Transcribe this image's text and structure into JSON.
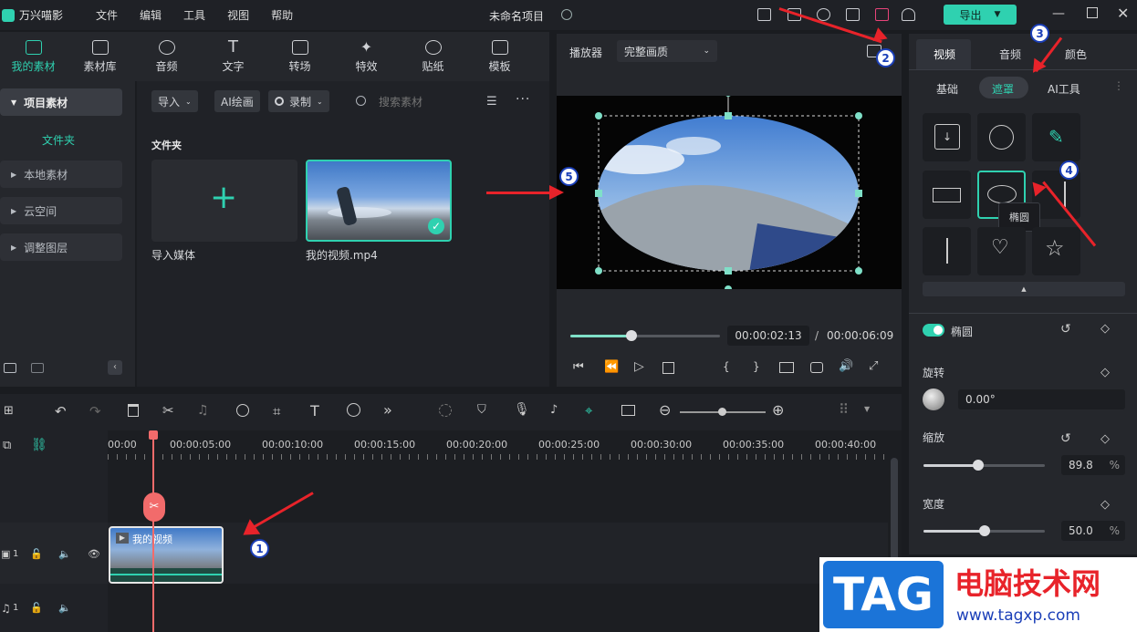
{
  "app": {
    "name": "万兴喵影",
    "project_title": "未命名项目"
  },
  "menu": [
    "文件",
    "编辑",
    "工具",
    "视图",
    "帮助"
  ],
  "export_label": "导出",
  "tabs": [
    {
      "label": "我的素材",
      "icon": "media-icon"
    },
    {
      "label": "素材库",
      "icon": "library-icon"
    },
    {
      "label": "音频",
      "icon": "music-icon"
    },
    {
      "label": "文字",
      "icon": "text-icon"
    },
    {
      "label": "转场",
      "icon": "transition-icon"
    },
    {
      "label": "特效",
      "icon": "effects-icon"
    },
    {
      "label": "贴纸",
      "icon": "sticker-icon"
    },
    {
      "label": "模板",
      "icon": "template-icon"
    }
  ],
  "sidebar": {
    "project_media": "项目素材",
    "folder": "文件夹",
    "items": [
      "本地素材",
      "云空间",
      "调整图层"
    ]
  },
  "media": {
    "import_label": "导入",
    "ai_draw_label": "AI绘画",
    "record_label": "录制",
    "search_placeholder": "搜索素材",
    "folder_heading": "文件夹",
    "import_media_label": "导入媒体",
    "video_name": "我的视频.mp4"
  },
  "player": {
    "label": "播放器",
    "quality": "完整画质",
    "current_time": "00:00:02:13",
    "separator": "/",
    "total_time": "00:00:06:09",
    "progress": 0.41
  },
  "right_panel": {
    "tabs": [
      "视频",
      "音频",
      "颜色"
    ],
    "subtabs": [
      "基础",
      "遮罩",
      "AI工具"
    ],
    "tooltip": "椭圆",
    "mask_name": "椭圆",
    "rotation_label": "旋转",
    "rotation_value": "0.00°",
    "scale_label": "缩放",
    "scale_value": "89.8",
    "scale_unit": "%",
    "scale_fraction": 0.898,
    "width_label": "宽度",
    "width_value": "50.0",
    "width_unit": "%",
    "width_fraction": 0.5
  },
  "timeline": {
    "ticks": [
      "00:00",
      "00:00:05:00",
      "00:00:10:00",
      "00:00:15:00",
      "00:00:20:00",
      "00:00:25:00",
      "00:00:30:00",
      "00:00:35:00",
      "00:00:40:00"
    ],
    "clip_label": "我的视频",
    "video_track": "1",
    "audio_track": "1"
  },
  "annotations": [
    "1",
    "2",
    "3",
    "4",
    "5"
  ],
  "watermark": {
    "tag": "TAG",
    "site_name": "电脑技术网",
    "url": "www.tagxp.com"
  },
  "colors": {
    "accent": "#2fd1b0",
    "arrow": "#e8232a",
    "badge": "#1b3fb8"
  }
}
